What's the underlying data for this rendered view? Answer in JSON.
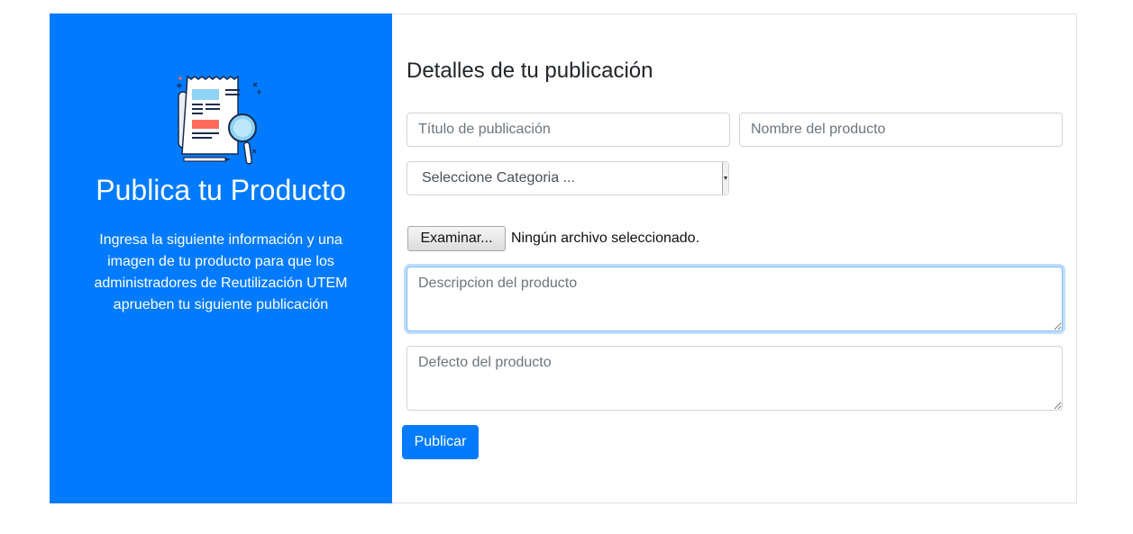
{
  "sidebar": {
    "title": "Publica tu Producto",
    "description": "Ingresa la siguiente información y una imagen de tu producto para que los administradores de Reutilización UTEM aprueben tu siguiente publicación",
    "illustration_icon": "newspaper-magnifier-icon"
  },
  "form": {
    "heading": "Detalles de tu publicación",
    "titulo_placeholder": "Título de publicación",
    "nombre_placeholder": "Nombre del producto",
    "categoria_selected": "Seleccione Categoria ...",
    "file_button_label": "Examinar...",
    "file_status": "Ningún archivo seleccionado.",
    "descripcion_placeholder": "Descripcion del producto",
    "defecto_placeholder": "Defecto del producto",
    "submit_label": "Publicar"
  },
  "colors": {
    "primary": "#007bff",
    "focus_border": "#80bdff"
  }
}
